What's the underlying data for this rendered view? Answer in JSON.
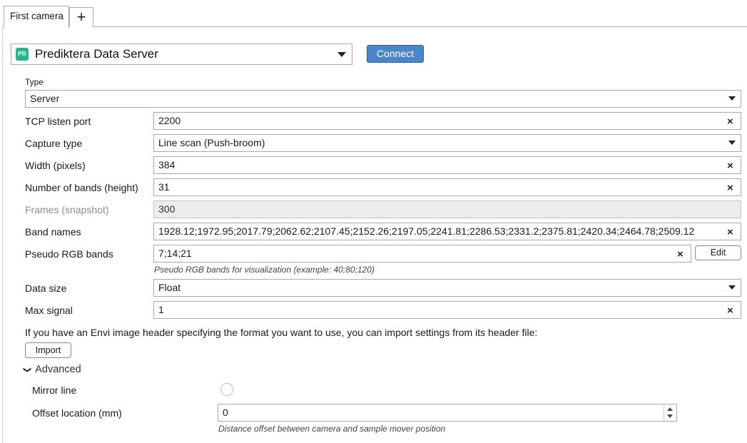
{
  "tabs": {
    "active_label": "First camera",
    "add_label": "+"
  },
  "connection": {
    "server_logo_text": "PR",
    "server_name": "Prediktera Data Server",
    "connect_label": "Connect"
  },
  "form": {
    "type_label": "Type",
    "type_value": "Server",
    "tcp_label": "TCP listen port",
    "tcp_value": "2200",
    "capture_label": "Capture type",
    "capture_value": "Line scan (Push-broom)",
    "width_label": "Width (pixels)",
    "width_value": "384",
    "bands_label": "Number of bands (height)",
    "bands_value": "31",
    "frames_label": "Frames (snapshot)",
    "frames_value": "300",
    "bandnames_label": "Band names",
    "bandnames_value": "1928.12;1972.95;2017.79;2062.62;2107.45;2152.26;2197.05;2241.81;2286.53;2331.2;2375.81;2420.34;2464.78;2509.12",
    "pseudo_label": "Pseudo RGB bands",
    "pseudo_value": "7;14;21",
    "pseudo_edit_label": "Edit",
    "pseudo_hint": "Pseudo RGB bands for visualization (example: 40;80;120)",
    "datasize_label": "Data size",
    "datasize_value": "Float",
    "maxsignal_label": "Max signal",
    "maxsignal_value": "1",
    "envi_text": "If you have an Envi image header specifying the format you want to use, you can import settings from its header file:",
    "import_label": "Import"
  },
  "advanced": {
    "toggle_label": "Advanced",
    "mirror_label": "Mirror line",
    "offset_label": "Offset location (mm)",
    "offset_value": "0",
    "offset_hint": "Distance offset between camera and sample mover position"
  },
  "icons": {
    "clear": "×",
    "chevron": "❯"
  },
  "colors": {
    "accent": "#4a86c8",
    "logo": "#29b588"
  }
}
